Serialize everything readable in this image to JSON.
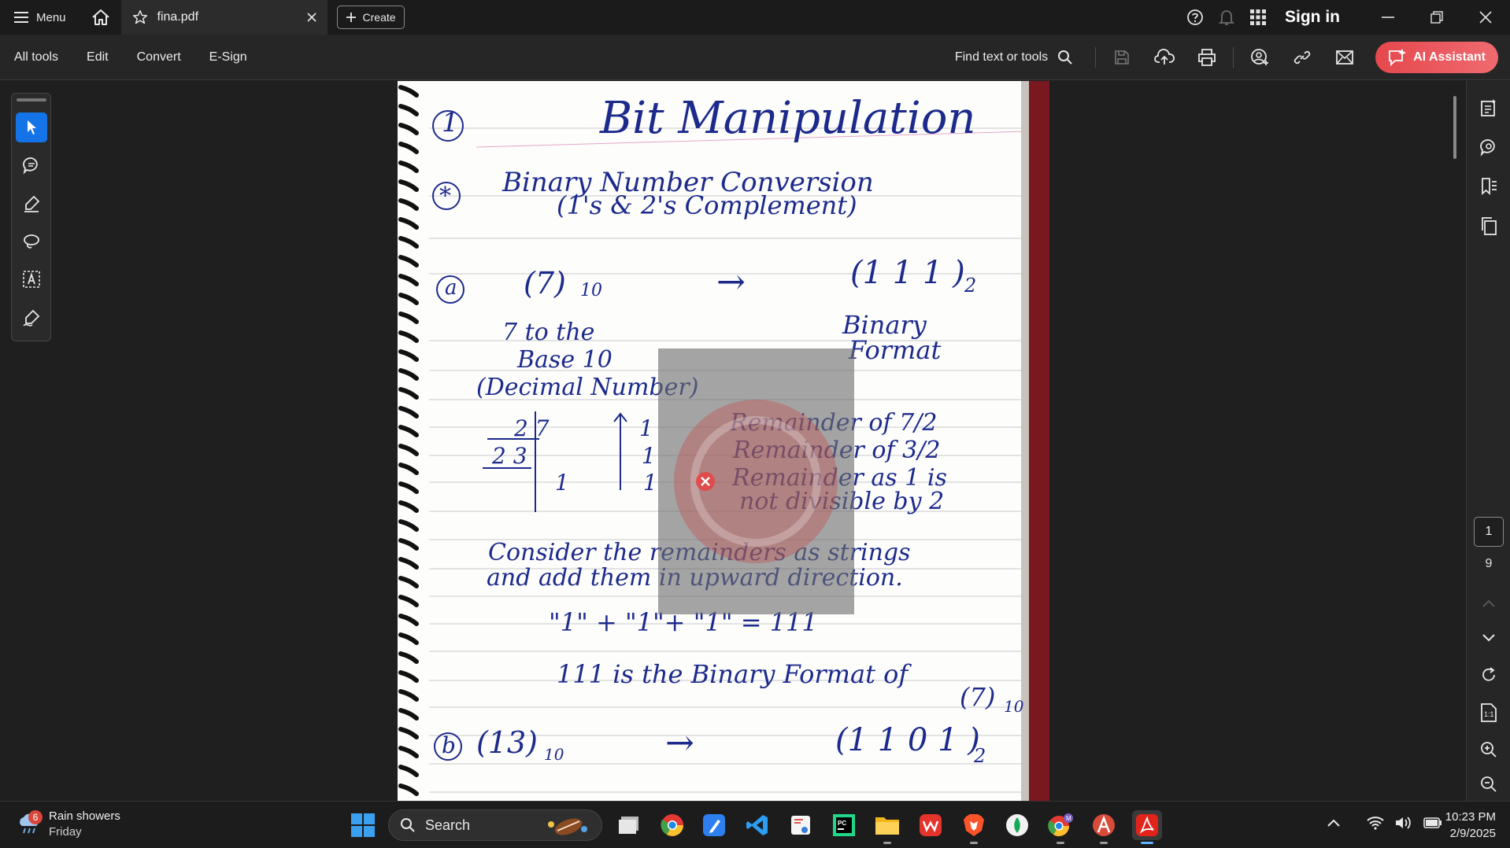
{
  "titlebar": {
    "menu_label": "Menu",
    "tab_title": "fina.pdf",
    "create_label": "Create",
    "sign_in": "Sign in"
  },
  "toolbar": {
    "items": [
      "All tools",
      "Edit",
      "Convert",
      "E-Sign"
    ],
    "find_label": "Find text or tools",
    "ai_label": "AI Assistant"
  },
  "document": {
    "lines": [
      "1",
      "Bit Manipulation",
      "*",
      "Binary Number Conversion",
      "(1's & 2's Complement)",
      "a",
      "(7)",
      "10",
      "→",
      "(1 1 1 )",
      "2",
      "7 to the",
      "Base 10",
      "(Decimal Number)",
      "Binary",
      "Format",
      "2 7",
      "2 3",
      "1",
      "1",
      "1",
      "1",
      "Remainder of 7/2",
      "Remainder of 3/2",
      "Remainder as 1 is",
      "not divisible by 2",
      "Consider the remainders as strings",
      "and add them in upward direction.",
      "\"1\" + \"1\"+ \"1\" = 111",
      "111 is the Binary Format of",
      "(7)",
      "10",
      "b",
      "(13)",
      "10",
      "→",
      "(1 1 0 1 )",
      "2"
    ]
  },
  "page_nav": {
    "current": "1",
    "total": "9"
  },
  "taskbar": {
    "weather_badge": "6",
    "weather_title": "Rain showers",
    "weather_sub": "Friday",
    "search_label": "Search",
    "time": "10:23 PM",
    "date": "2/9/2025"
  },
  "colors": {
    "accent_blue": "#1473e6",
    "ai_red": "#e5484d",
    "ink": "#1c2a8c"
  },
  "icons": [
    "hamburger-icon",
    "home-icon",
    "star-icon",
    "close-icon",
    "plus-icon",
    "help-icon",
    "bell-icon",
    "apps-grid-icon",
    "minimize-icon",
    "maximize-icon",
    "search-icon",
    "save-icon",
    "upload-icon",
    "print-icon",
    "share-icon",
    "link-icon",
    "mail-icon",
    "ai-icon"
  ]
}
